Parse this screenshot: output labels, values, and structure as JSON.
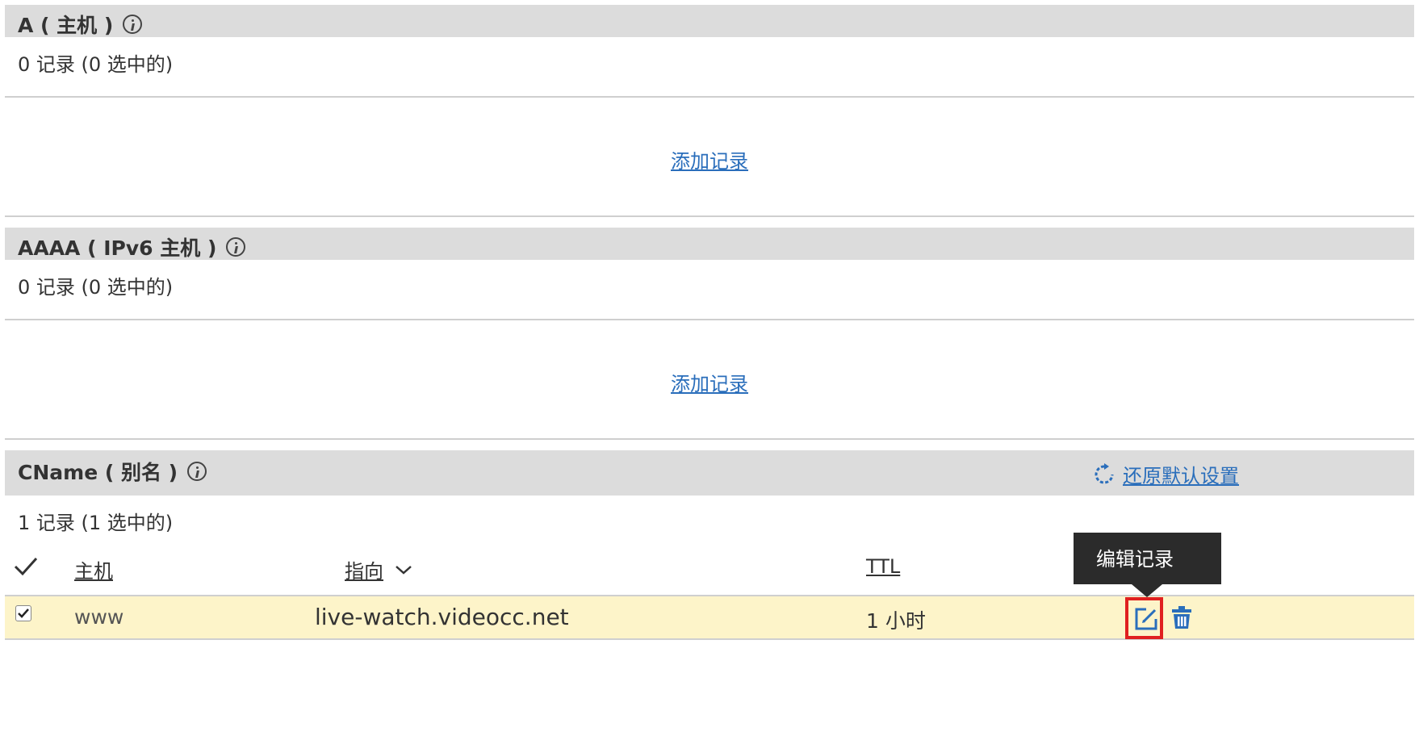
{
  "sections": [
    {
      "title": "A ( 主机 )",
      "count": "0 记录 (0 选中的)",
      "add_link": "添加记录"
    },
    {
      "title": "AAAA ( IPv6 主机 )",
      "count": "0 记录 (0 选中的)",
      "add_link": "添加记录"
    },
    {
      "title": "CName ( 别名 )",
      "count": "1 记录 (1 选中的)",
      "restore_link": "还原默认设置",
      "columns": {
        "host": "主机",
        "points_to": "指向",
        "ttl": "TTL"
      },
      "rows": [
        {
          "checked": true,
          "host": "www",
          "points_to": "live-watch.videocc.net",
          "ttl": "1 小时"
        }
      ]
    }
  ],
  "tooltip": "编辑记录",
  "icons": {
    "info": "info-icon",
    "restore": "refresh-icon",
    "edit": "edit-icon",
    "delete": "trash-icon",
    "select_all": "checkmark-icon",
    "sort": "chevron-down-icon"
  },
  "colors": {
    "header_bg": "#dcdcdc",
    "link": "#2a6ebb",
    "selected_row": "#fdf4c9",
    "highlight_border": "#e02020",
    "tooltip_bg": "#2b2b2b"
  }
}
